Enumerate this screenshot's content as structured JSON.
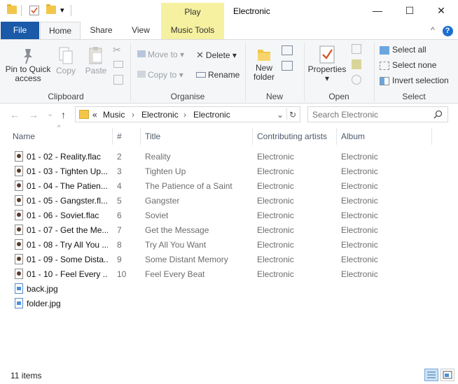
{
  "window": {
    "title": "Electronic",
    "context_tab": "Play",
    "minimize_glyph": "—",
    "maximize_glyph": "☐",
    "close_glyph": "✕"
  },
  "quick_access": {
    "dropdown_glyph": "▾"
  },
  "ribbon_tabs": {
    "file": "File",
    "home": "Home",
    "share": "Share",
    "view": "View",
    "music_tools": "Music Tools",
    "collapse_glyph": "^",
    "help_glyph": "?"
  },
  "ribbon": {
    "clipboard": {
      "label": "Clipboard",
      "pin_line1": "Pin to Quick",
      "pin_line2": "access",
      "copy": "Copy",
      "paste": "Paste"
    },
    "organise": {
      "label": "Organise",
      "move_to": "Move to",
      "copy_to": "Copy to",
      "delete": "Delete",
      "rename": "Rename"
    },
    "new": {
      "label": "New",
      "new_folder_line1": "New",
      "new_folder_line2": "folder"
    },
    "open": {
      "label": "Open",
      "properties": "Properties"
    },
    "select": {
      "label": "Select",
      "select_all": "Select all",
      "select_none": "Select none",
      "invert_selection": "Invert selection"
    }
  },
  "navigation": {
    "back_glyph": "←",
    "forward_glyph": "→",
    "recent_glyph": "⌄",
    "up_glyph": "↑",
    "overflow": "«",
    "breadcrumb": [
      "Music",
      "Electronic",
      "Electronic"
    ],
    "crumb_sep": "›",
    "dropdown_glyph": "⌄",
    "refresh_glyph": "↻",
    "search_placeholder": "Search Electronic"
  },
  "columns": {
    "name": "Name",
    "number": "#",
    "title": "Title",
    "artists": "Contributing artists",
    "album": "Album"
  },
  "files": [
    {
      "name": "01 - 02 - Reality.flac",
      "number": "2",
      "title": "Reality",
      "artists": "Electronic",
      "album": "Electronic",
      "type": "audio"
    },
    {
      "name": "01 - 03 - Tighten Up...",
      "number": "3",
      "title": "Tighten Up",
      "artists": "Electronic",
      "album": "Electronic",
      "type": "audio"
    },
    {
      "name": "01 - 04 - The Patien...",
      "number": "4",
      "title": "The Patience of a Saint",
      "artists": "Electronic",
      "album": "Electronic",
      "type": "audio"
    },
    {
      "name": "01 - 05 - Gangster.fl...",
      "number": "5",
      "title": "Gangster",
      "artists": "Electronic",
      "album": "Electronic",
      "type": "audio"
    },
    {
      "name": "01 - 06 - Soviet.flac",
      "number": "6",
      "title": "Soviet",
      "artists": "Electronic",
      "album": "Electronic",
      "type": "audio"
    },
    {
      "name": "01 - 07 - Get the Me...",
      "number": "7",
      "title": "Get the Message",
      "artists": "Electronic",
      "album": "Electronic",
      "type": "audio"
    },
    {
      "name": "01 - 08 - Try All You ...",
      "number": "8",
      "title": "Try All You Want",
      "artists": "Electronic",
      "album": "Electronic",
      "type": "audio"
    },
    {
      "name": "01 - 09 - Some Dista...",
      "number": "9",
      "title": "Some Distant Memory",
      "artists": "Electronic",
      "album": "Electronic",
      "type": "audio"
    },
    {
      "name": "01 - 10 - Feel Every ...",
      "number": "10",
      "title": "Feel Every Beat",
      "artists": "Electronic",
      "album": "Electronic",
      "type": "audio"
    },
    {
      "name": "back.jpg",
      "number": "",
      "title": "",
      "artists": "",
      "album": "",
      "type": "image"
    },
    {
      "name": "folder.jpg",
      "number": "",
      "title": "",
      "artists": "",
      "album": "",
      "type": "image"
    }
  ],
  "status": {
    "item_count": "11 items"
  },
  "colors": {
    "file_tab": "#1a5aa8",
    "music_tools_tab": "#f6f1a0",
    "folder_yellow": "#f3c64a"
  }
}
